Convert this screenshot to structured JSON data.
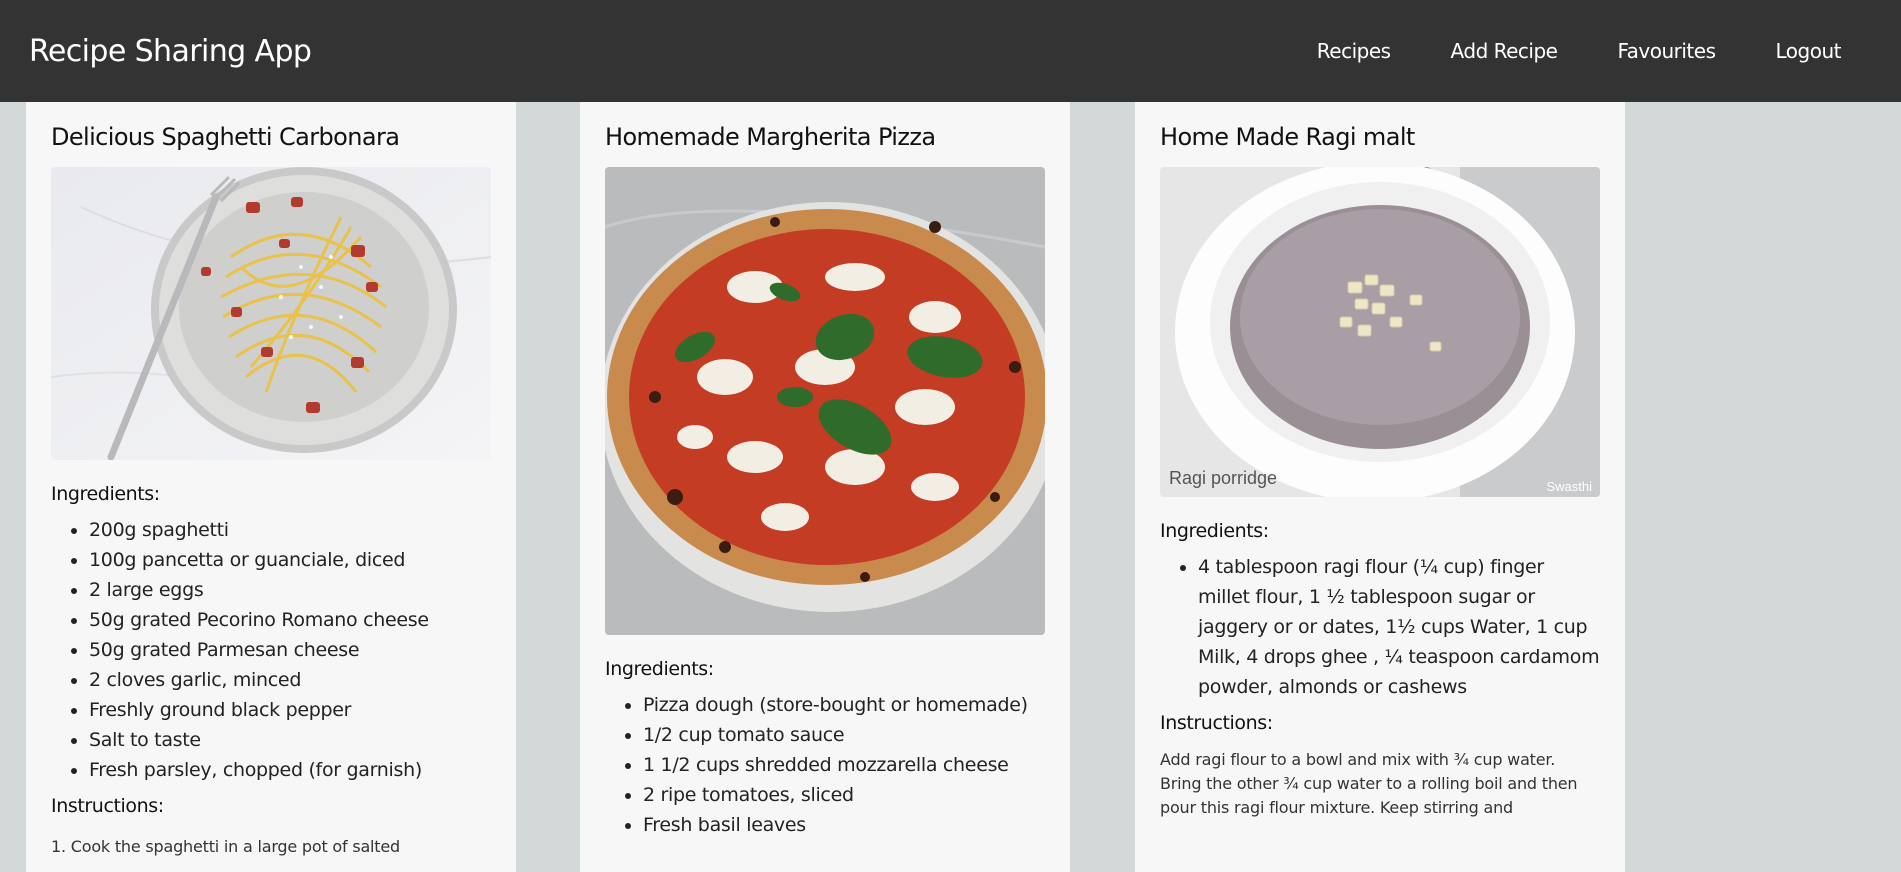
{
  "header": {
    "app_title": "Recipe Sharing App",
    "nav": [
      {
        "label": "Recipes"
      },
      {
        "label": "Add Recipe"
      },
      {
        "label": "Favourites"
      },
      {
        "label": "Logout"
      }
    ]
  },
  "recipes": [
    {
      "title": "Delicious Spaghetti Carbonara",
      "ingredients_heading": "Ingredients:",
      "ingredients": [
        "200g spaghetti",
        "100g pancetta or guanciale, diced",
        "2 large eggs",
        "50g grated Pecorino Romano cheese",
        "50g grated Parmesan cheese",
        "2 cloves garlic, minced",
        "Freshly ground black pepper",
        "Salt to taste",
        "Fresh parsley, chopped (for garnish)"
      ],
      "instructions_heading": "Instructions:",
      "instructions": "1. Cook the spaghetti in a large pot of salted"
    },
    {
      "title": "Homemade Margherita Pizza",
      "ingredients_heading": "Ingredients:",
      "ingredients": [
        "Pizza dough (store-bought or homemade)",
        "1/2 cup tomato sauce",
        "1 1/2 cups shredded mozzarella cheese",
        "2 ripe tomatoes, sliced",
        "Fresh basil leaves"
      ]
    },
    {
      "title": "Home Made Ragi malt",
      "image_caption": "Ragi porridge",
      "image_credit": "Swasthi",
      "ingredients_heading": "Ingredients:",
      "ingredients": [
        "4 tablespoon ragi flour (¼ cup) finger millet flour, 1 ½ tablespoon sugar or jaggery or or dates, 1½ cups Water, 1 cup Milk, 4 drops ghee , ¼ teaspoon cardamom powder, almonds or cashews"
      ],
      "instructions_heading": "Instructions:",
      "instructions": "Add ragi flour to a bowl and mix with ¾ cup water. Bring the other ¾ cup water to a rolling boil and then pour this ragi flour mixture. Keep stirring and"
    }
  ],
  "colors": {
    "navbar_bg": "#333333",
    "page_bg": "#d3d8d9",
    "card_bg": "#f7f7f7"
  }
}
